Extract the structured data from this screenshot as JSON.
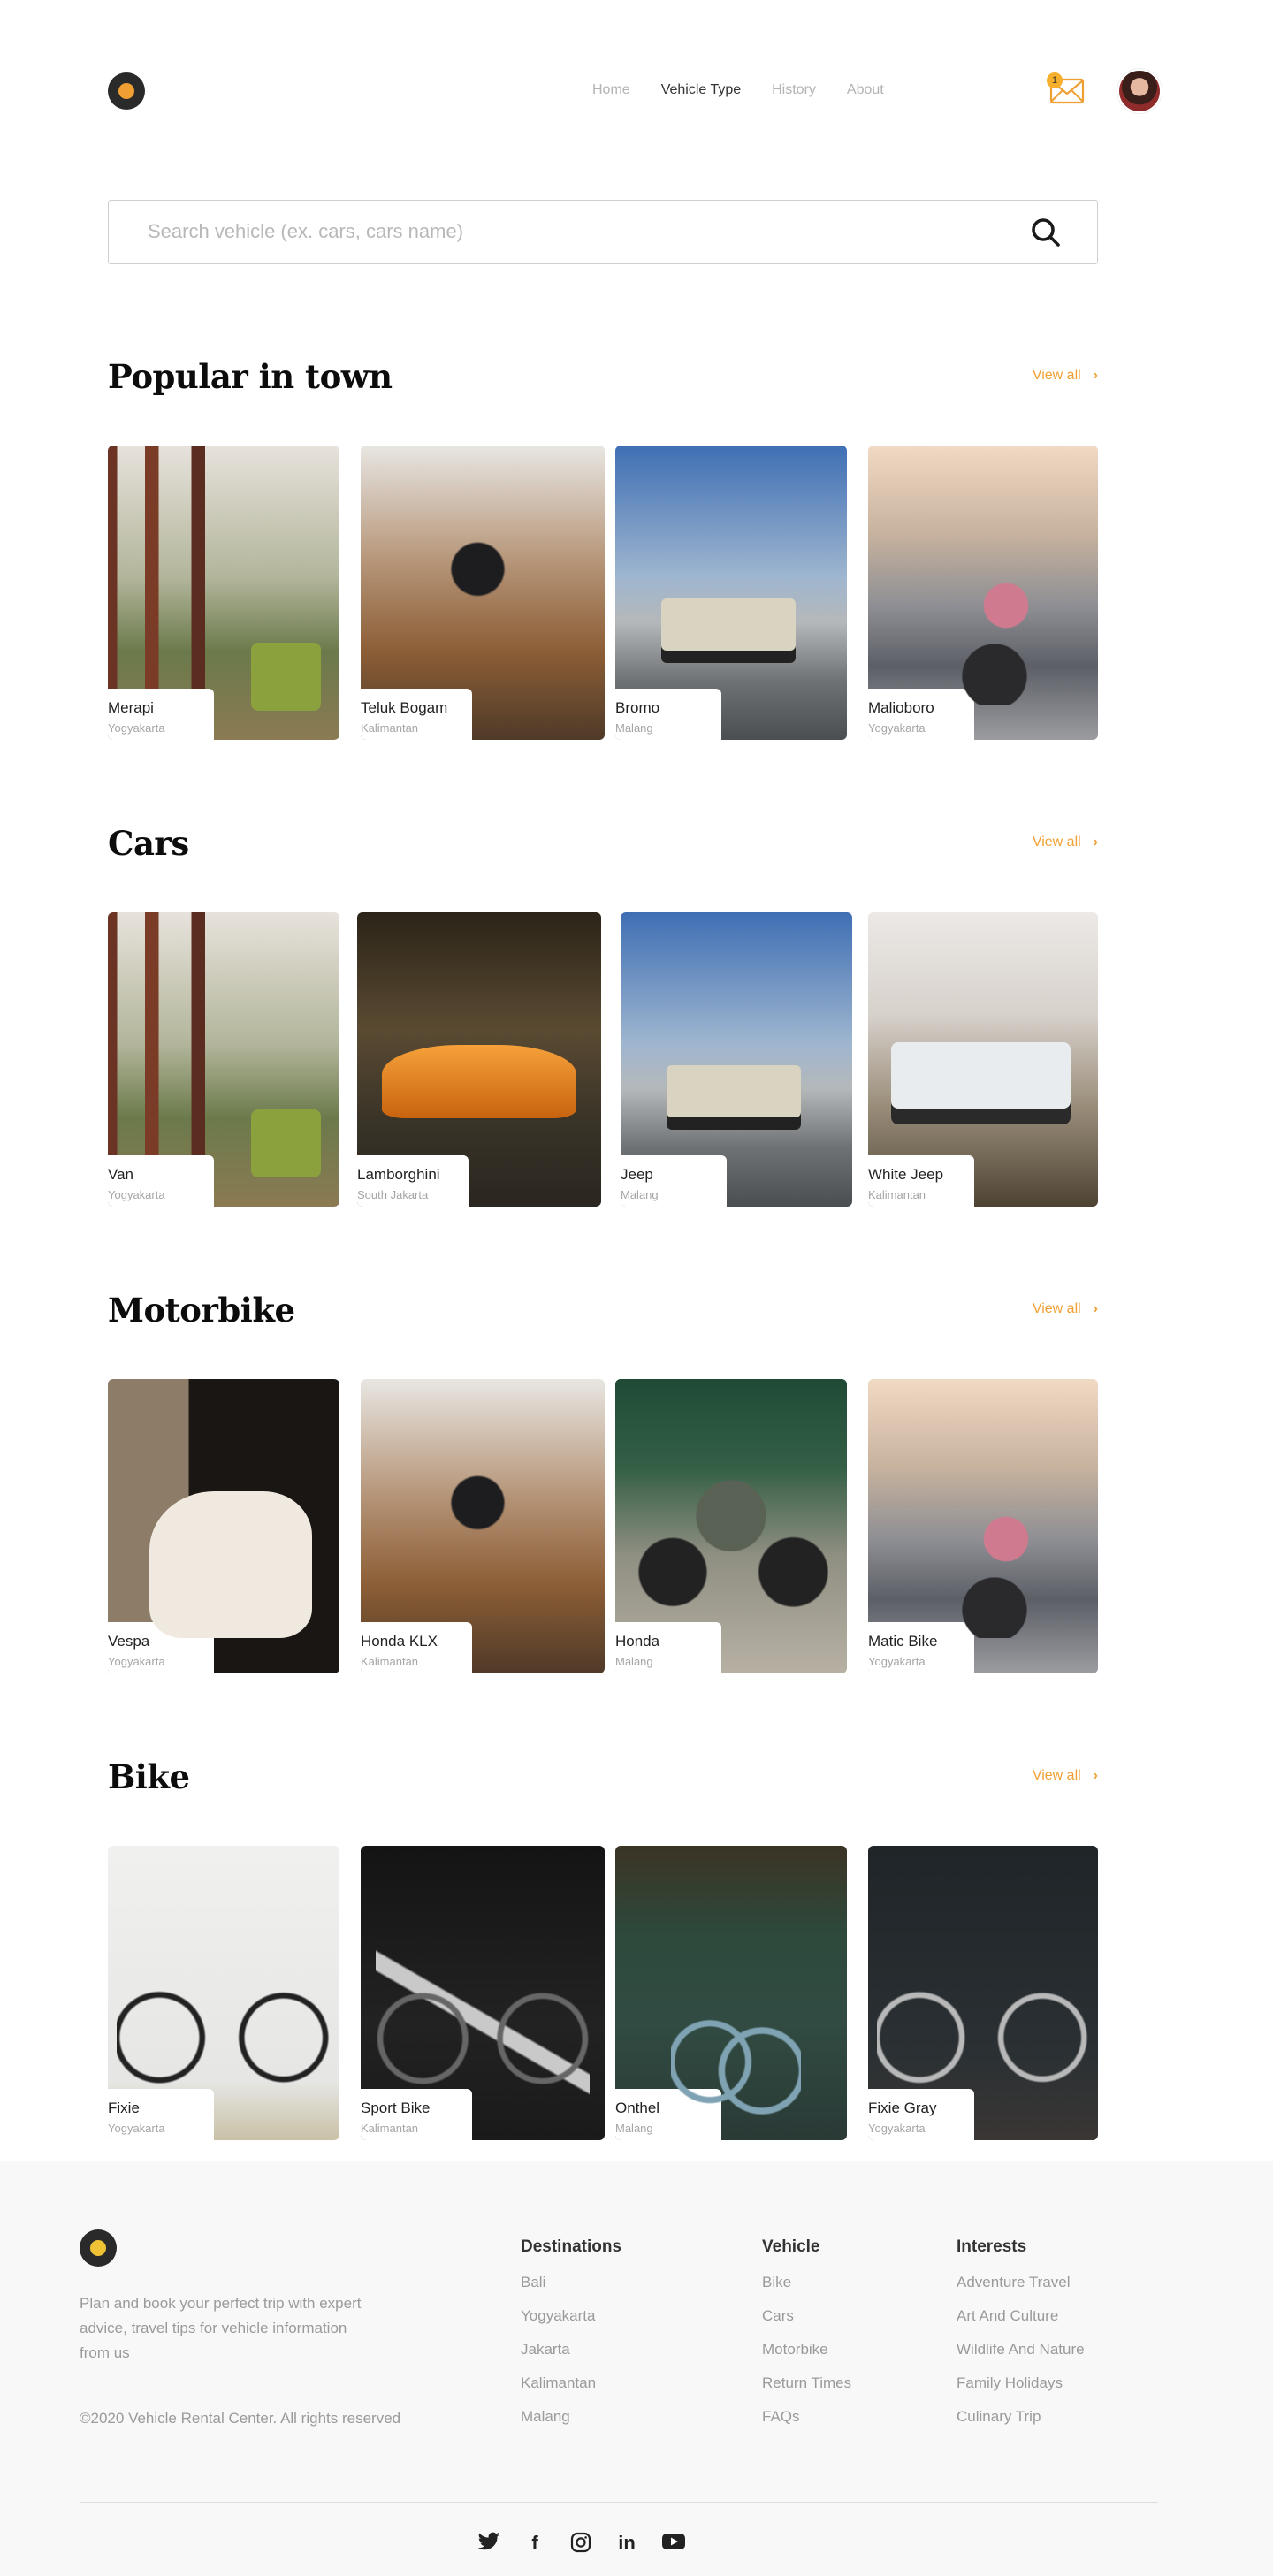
{
  "nav": {
    "items": [
      {
        "label": "Home",
        "active": false
      },
      {
        "label": "Vehicle Type",
        "active": true
      },
      {
        "label": "History",
        "active": false
      },
      {
        "label": "About",
        "active": false
      }
    ],
    "mail_badge": "1"
  },
  "search": {
    "placeholder": "Search vehicle (ex. cars, cars name)",
    "value": ""
  },
  "sections": [
    {
      "title": "Popular in town",
      "view_all": "View all",
      "cards": [
        {
          "name": "Merapi",
          "location": "Yogyakarta"
        },
        {
          "name": "Teluk Bogam",
          "location": "Kalimantan"
        },
        {
          "name": "Bromo",
          "location": "Malang"
        },
        {
          "name": "Malioboro",
          "location": "Yogyakarta"
        }
      ]
    },
    {
      "title": "Cars",
      "view_all": "View all",
      "cards": [
        {
          "name": "Van",
          "location": "Yogyakarta"
        },
        {
          "name": "Lamborghini",
          "location": "South Jakarta"
        },
        {
          "name": "Jeep",
          "location": "Malang"
        },
        {
          "name": "White Jeep",
          "location": "Kalimantan"
        }
      ]
    },
    {
      "title": "Motorbike",
      "view_all": "View all",
      "cards": [
        {
          "name": "Vespa",
          "location": "Yogyakarta"
        },
        {
          "name": "Honda KLX",
          "location": "Kalimantan"
        },
        {
          "name": "Honda",
          "location": "Malang"
        },
        {
          "name": "Matic Bike",
          "location": "Yogyakarta"
        }
      ]
    },
    {
      "title": "Bike",
      "view_all": "View all",
      "cards": [
        {
          "name": "Fixie",
          "location": "Yogyakarta"
        },
        {
          "name": "Sport Bike",
          "location": "Kalimantan"
        },
        {
          "name": "Onthel",
          "location": "Malang"
        },
        {
          "name": "Fixie Gray",
          "location": "Yogyakarta"
        }
      ]
    }
  ],
  "footer": {
    "description": "Plan and book your perfect trip with expert advice, travel tips for vehicle information from us",
    "copyright": "©2020 Vehicle Rental Center. All rights reserved",
    "columns": [
      {
        "title": "Destinations",
        "links": [
          "Bali",
          "Yogyakarta",
          "Jakarta",
          "Kalimantan",
          "Malang"
        ]
      },
      {
        "title": "Vehicle",
        "links": [
          "Bike",
          "Cars",
          "Motorbike",
          "Return Times",
          "FAQs"
        ]
      },
      {
        "title": "Interests",
        "links": [
          "Adventure Travel",
          "Art And Culture",
          "Wildlife And Nature",
          "Family Holidays",
          "Culinary Trip"
        ]
      }
    ],
    "socials": [
      "twitter-icon",
      "facebook-icon",
      "instagram-icon",
      "linkedin-icon",
      "youtube-icon"
    ]
  },
  "colors": {
    "accent": "#f0a033",
    "text_dark": "#0c0c0c",
    "muted": "#9a9a9a"
  }
}
